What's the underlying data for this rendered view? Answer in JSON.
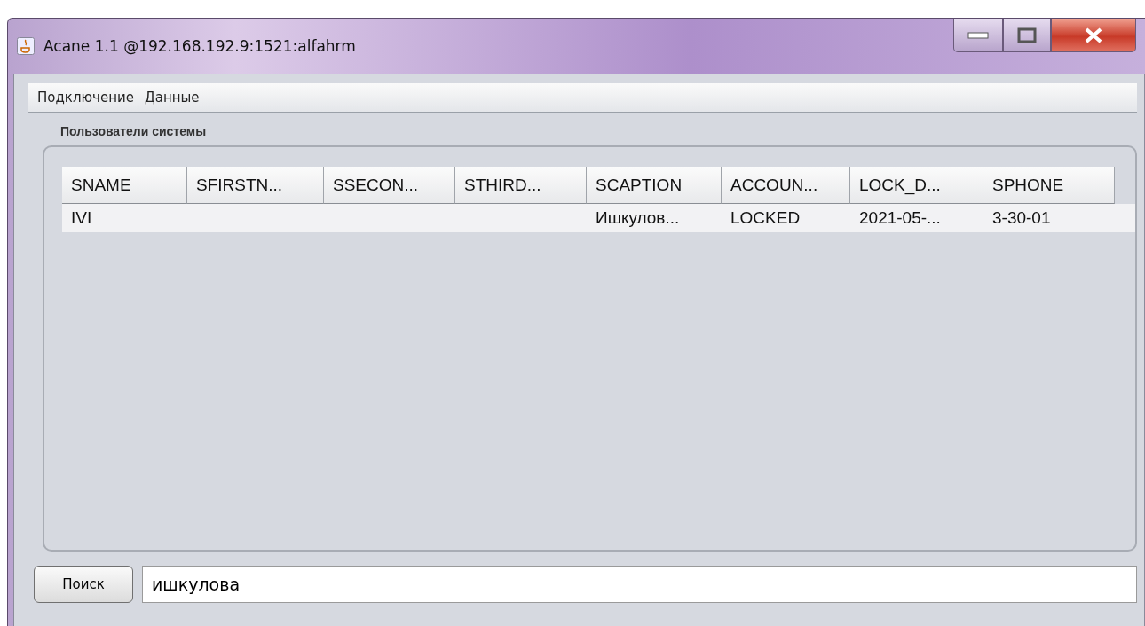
{
  "window": {
    "title": "Acane 1.1 @192.168.192.9:1521:alfahrm"
  },
  "menu": [
    "Подключение",
    "Данные"
  ],
  "panel": {
    "title": "Пользователи системы"
  },
  "table": {
    "columns": [
      "SNAME",
      "SFIRSTN...",
      "SSECON...",
      "STHIRD...",
      "SCAPTION",
      "ACCOUN...",
      "LOCK_D...",
      "SPHONE"
    ],
    "rows": [
      {
        "cells": [
          "IVI",
          "",
          "",
          "",
          "Ишкулов...",
          "LOCKED",
          "2021-05-...",
          "3-30-01"
        ],
        "selected": false
      }
    ]
  },
  "search": {
    "button": "Поиск",
    "value": "ишкулова"
  }
}
